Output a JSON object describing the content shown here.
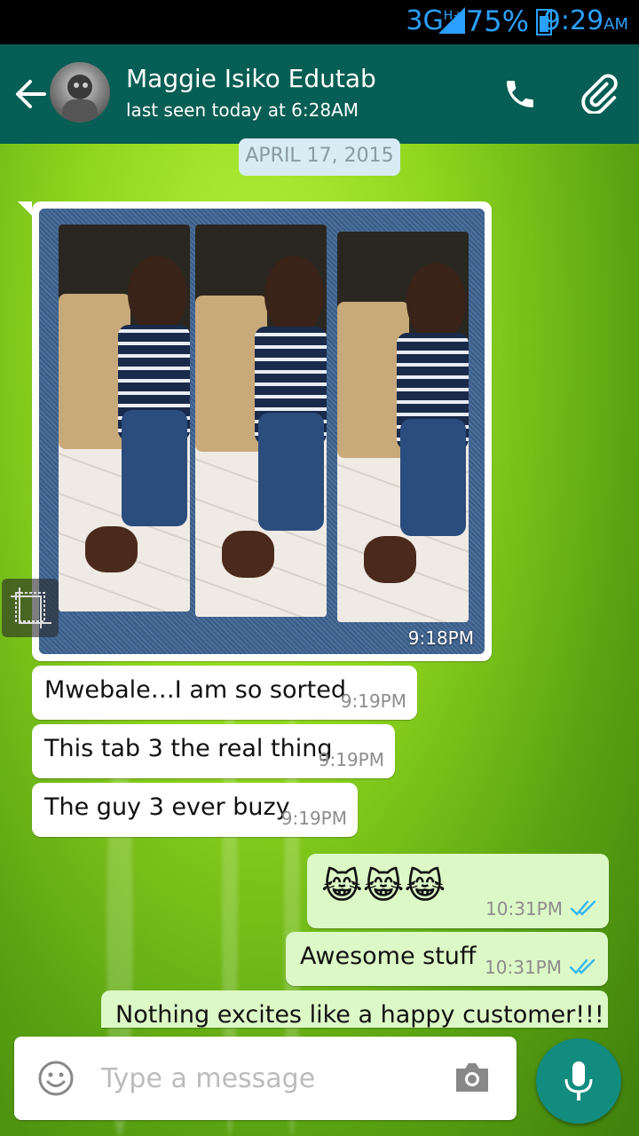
{
  "status_bar": {
    "network": "3G",
    "network_sup": "H+",
    "battery": "75%",
    "time": "9:29",
    "ampm": "AM"
  },
  "header": {
    "contact_name": "Maggie Isiko Edutab",
    "last_seen": "last seen today at 6:28AM"
  },
  "date_divider": "APRIL 17, 2015",
  "image_message": {
    "time": "9:18PM"
  },
  "incoming": [
    {
      "text": "Mwebale…I am so sorted",
      "time": "9:19PM"
    },
    {
      "text": "This tab 3 the real thing",
      "time": "9:19PM"
    },
    {
      "text": "The guy 3 ever buzy",
      "time": "9:19PM"
    }
  ],
  "outgoing": [
    {
      "text": "😹😹😹",
      "time": "10:31PM",
      "status": "read"
    },
    {
      "text": "Awesome stuff",
      "time": "10:31PM",
      "status": "read"
    },
    {
      "text": "Nothing excites like a happy customer!!!"
    }
  ],
  "composer": {
    "placeholder": "Type a message"
  },
  "colors": {
    "appbar": "#075e54",
    "statusbar_text": "#2aa0ff",
    "outgoing_bubble": "#dcf8c6",
    "read_ticks": "#34b7f1",
    "mic_button": "#128c7e"
  },
  "icons": {
    "back": "arrow-left",
    "call": "phone",
    "attach": "paperclip",
    "emoji": "smiley",
    "camera": "camera",
    "mic": "microphone"
  }
}
